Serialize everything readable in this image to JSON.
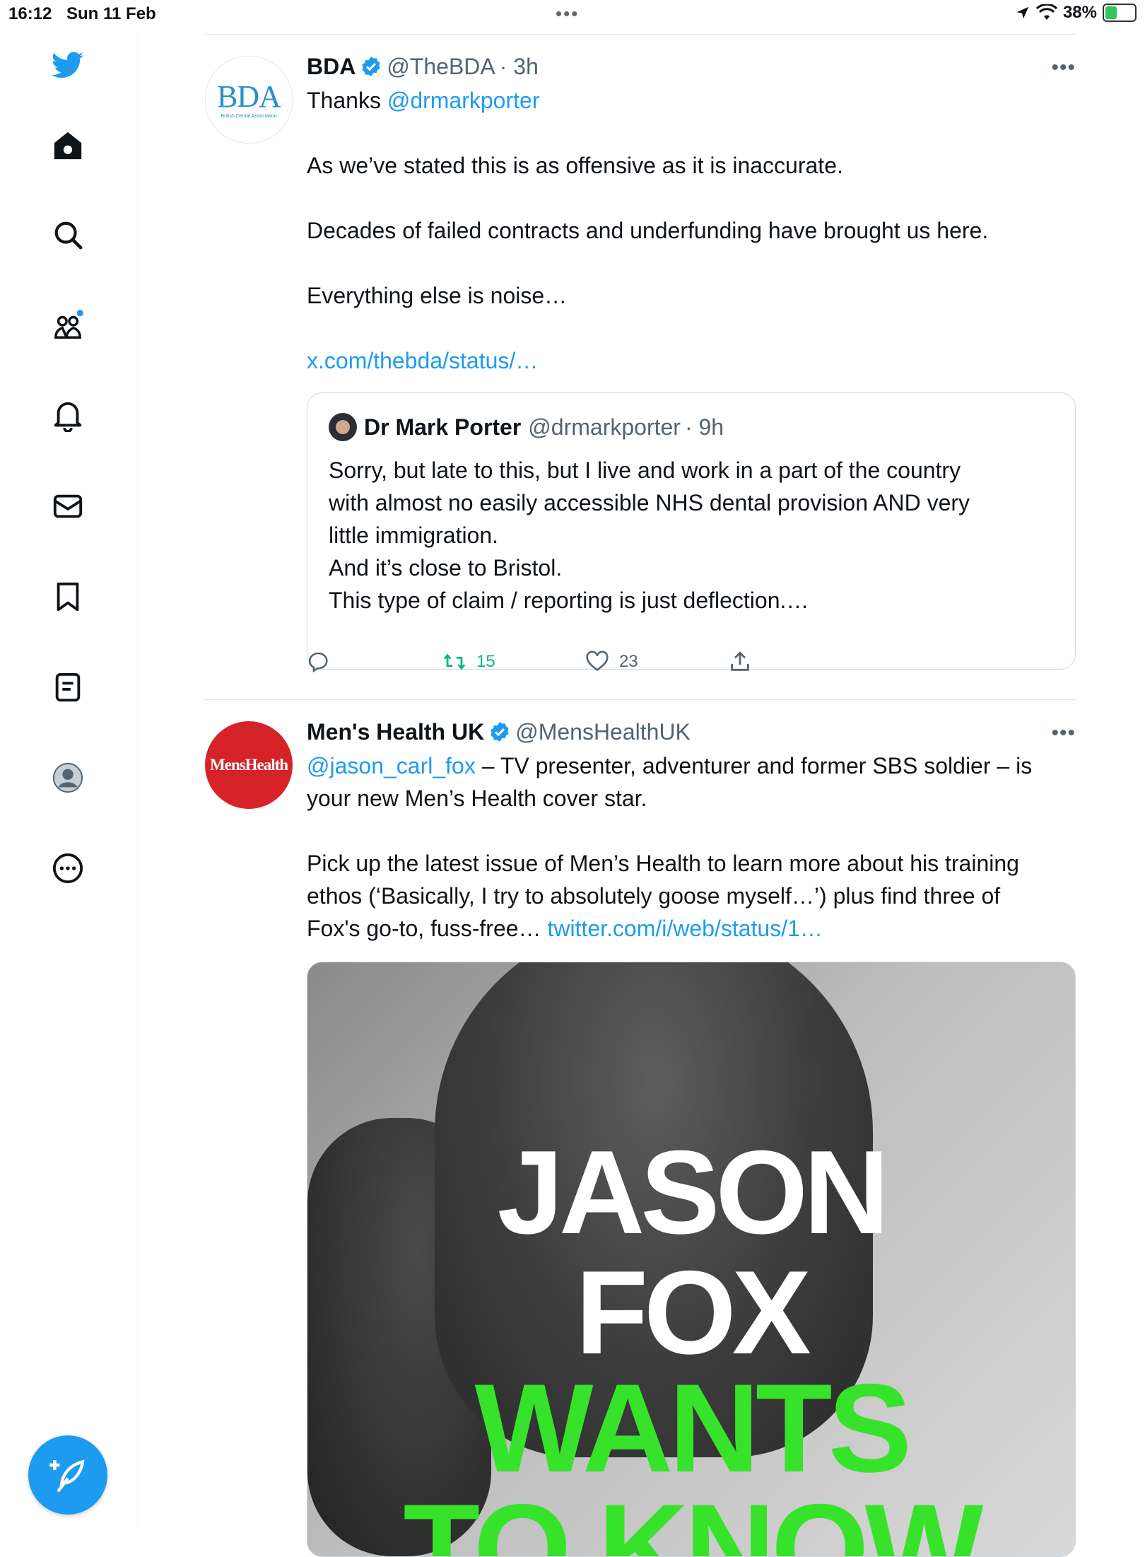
{
  "status_bar": {
    "time": "16:12",
    "date": "Sun 11 Feb",
    "dots": "•••",
    "battery": "38%"
  },
  "sidebar": {
    "items": [
      {
        "icon": "twitter-logo-icon"
      },
      {
        "icon": "home-icon"
      },
      {
        "icon": "search-icon"
      },
      {
        "icon": "communities-icon"
      },
      {
        "icon": "notifications-bell-icon"
      },
      {
        "icon": "messages-envelope-icon"
      },
      {
        "icon": "bookmark-icon"
      },
      {
        "icon": "lists-icon"
      },
      {
        "icon": "profile-avatar-icon"
      },
      {
        "icon": "more-circle-icon"
      }
    ],
    "compose_icon": "compose-feather-icon"
  },
  "tweets": [
    {
      "name": "BDA",
      "handle": "@TheBDA",
      "time": "· 3h",
      "avatar_text": "BDA",
      "avatar_subtext": "British Dental Association",
      "lines": {
        "thanks": "Thanks ",
        "mention": "@drmarkporter",
        "p1": "As we’ve stated this is as offensive as it is inaccurate.",
        "p2": "Decades of failed contracts and underfunding have brought us here.",
        "p3": "Everything else is noise…",
        "link": "x.com/thebda/status/…"
      },
      "quote": {
        "name": "Dr Mark Porter",
        "handle": "@drmarkporter",
        "time": "· 9h",
        "lines": [
          "Sorry, but late to this, but I live and work in a part of the country",
          "with almost no easily accessible NHS dental provision AND very",
          "little immigration.",
          "And it’s close to Bristol.",
          "This type of claim / reporting is just deflection.…"
        ]
      },
      "retweets": "15",
      "likes": "23"
    },
    {
      "name": "Men's Health UK",
      "handle": "@MensHealthUK",
      "avatar_text": "MensHealth",
      "lines": {
        "mention": "@jason_carl_fox",
        "l1_rest": " – TV presenter, adventurer and former SBS soldier – is",
        "l2": "your new Men’s Health cover star.",
        "p2_l1": "Pick up the latest issue of Men’s Health to learn more about his training",
        "p2_l2": "ethos (‘Basically, I try to absolutely goose myself…’) plus find three of",
        "p2_l3": "Fox's go-to, fuss-free… ",
        "link": "twitter.com/i/web/status/1…"
      },
      "media": {
        "line1": "JASON",
        "line2": "FOX",
        "line3": "WANTS",
        "line4": "TO KNOW"
      }
    }
  ],
  "colors": {
    "accent": "#1d9bf0",
    "retweet": "#00ba7c",
    "cover_green": "#37e32a",
    "mh_red": "#d6232a"
  }
}
